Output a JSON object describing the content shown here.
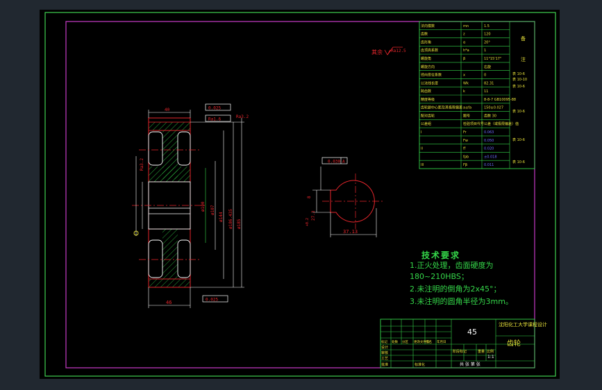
{
  "colors": {
    "background_outer": "#212830",
    "sheet": "#000000",
    "outer_border": "#3fd04f",
    "inner_border": "#c83bc8",
    "red_lines": "#e8262c",
    "green_lines": "#35d84a",
    "white_lines": "#ffffff",
    "yellow_text": "#e8e23a",
    "cyan_text": "#3bd7d7",
    "blue_text": "#6d6dff",
    "hatch": "#35d84a"
  },
  "icons": {
    "roughness_symbol": "check-triangle-icon",
    "datum_symbol": "datum-circle-icon"
  },
  "surface_finish_note": {
    "prefix": "其余",
    "value": "Ra12.5"
  },
  "front_view": {
    "dims": {
      "top_width": "40",
      "tol_top": "0.025",
      "tol_top2": "Ra1.6",
      "ra_right": "Ra3.2",
      "ra_left": "Ra3.2",
      "dia1": "ø100",
      "dia2": "ø107",
      "dia3": "ø144",
      "dia4": "ø186.435",
      "dia5": "ø185",
      "bottom_width": "46",
      "tol_bottom": "0.025"
    }
  },
  "side_view": {
    "tol_frame": "0.030",
    "datum": "A",
    "dim_width": "8",
    "dim_height": "27.3",
    "dim_sup": "+0.2",
    "dim_depth": "37.13"
  },
  "tech_requirements": {
    "title": "技术要求",
    "lines": [
      "1.正火处理，齿面硬度为",
      "180~210HBS；",
      "2.未注明的倒角为2x45°；",
      "3.未注明的圆角半径为3mm。"
    ]
  },
  "param_table": {
    "rows": [
      {
        "label": "法向模数",
        "sym": "mn",
        "val": "1.5"
      },
      {
        "label": "齿数",
        "sym": "z",
        "val": "120"
      },
      {
        "label": "齿形角",
        "sym": "α",
        "val": "20°"
      },
      {
        "label": "齿顶高系数",
        "sym": "h*a",
        "val": "1"
      },
      {
        "label": "螺旋角",
        "sym": "β",
        "val": "11°15'17\""
      },
      {
        "label": "螺旋方向",
        "sym": "",
        "val": "右旋"
      },
      {
        "label": "径向变位系数",
        "sym": "x",
        "val": "0"
      },
      {
        "label": "公法线长度",
        "sym": "Wk",
        "val": "82.31"
      },
      {
        "label": "跨齿数",
        "sym": "k",
        "val": "11"
      },
      {
        "label": "精度等级",
        "sym": "",
        "val": "8-8-7 GB10095-88"
      },
      {
        "label": "齿轮副中心距及其极限偏差",
        "sym": "a±fa",
        "val": "150±0.027"
      },
      {
        "label": "配对齿轮",
        "sym": "图号",
        "val": "齿数 30"
      },
      {
        "label": "公差组",
        "sym": "检验项目代号",
        "val": "公差（或极限偏差）值"
      },
      {
        "label": "I",
        "sym": "Fr",
        "val": "0.063"
      },
      {
        "label": "",
        "sym": "Fw",
        "val": "0.050"
      },
      {
        "label": "II",
        "sym": "ff",
        "val": "0.020"
      },
      {
        "label": "",
        "sym": "fpb",
        "val": "±0.018"
      },
      {
        "label": "III",
        "sym": "Fβ",
        "val": "0.011"
      }
    ],
    "side_notes": [
      "备",
      "注"
    ],
    "right_refs": [
      "表 10-6",
      "表 10-10",
      "表 10-6",
      "表 10-6",
      "表 10-6",
      "表 10-6"
    ]
  },
  "title_block": {
    "material": "45",
    "school": "沈阳化工大学课程设计",
    "part_name": "齿轮",
    "cols": [
      "标记",
      "处数",
      "分区",
      "更改文件号",
      "签名",
      "年月日"
    ],
    "rows": [
      "设计",
      "审核",
      "工艺",
      "批准"
    ],
    "standard": "标准化",
    "stage_header": [
      "阶段标记",
      "重量",
      "比例"
    ],
    "scale": "1:1",
    "sheets": "共 张 第 张"
  }
}
